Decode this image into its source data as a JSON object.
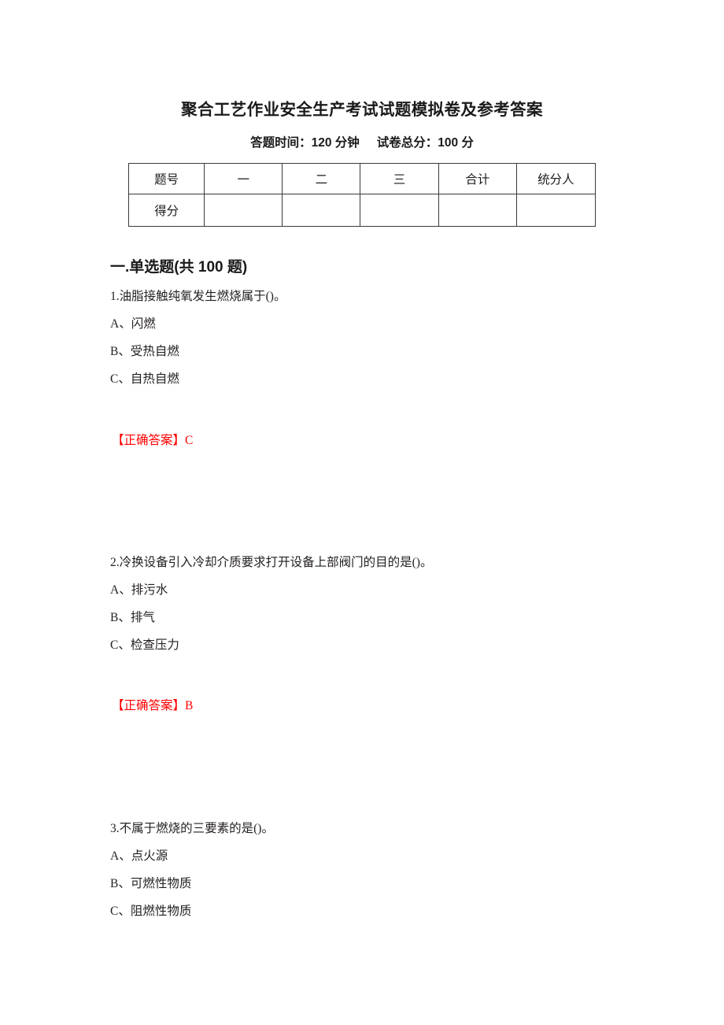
{
  "document": {
    "title": "聚合工艺作业安全生产考试试题模拟卷及参考答案",
    "subtitle_time": "答题时间：120 分钟",
    "subtitle_total": "试卷总分：100 分",
    "answer_color": "#ff0000",
    "text_color": "#231f20"
  },
  "score_table": {
    "header_row": [
      "题号",
      "一",
      "二",
      "三",
      "合计",
      "统分人"
    ],
    "score_row": [
      "得分",
      "",
      "",
      "",
      "",
      ""
    ]
  },
  "sections": [
    {
      "heading": "一.单选题(共 100 题)"
    }
  ],
  "questions": [
    {
      "stem": "1.油脂接触纯氧发生燃烧属于()。",
      "options": [
        {
          "key": "A、",
          "text": "闪燃"
        },
        {
          "key": "B、",
          "text": "受热自燃"
        },
        {
          "key": "C、",
          "text": "自热自燃"
        }
      ],
      "answer_label": "【正确答案】",
      "answer_value": "C"
    },
    {
      "stem": "2.冷换设备引入冷却介质要求打开设备上部阀门的目的是()。",
      "options": [
        {
          "key": "A、",
          "text": "排污水"
        },
        {
          "key": "B、",
          "text": "排气"
        },
        {
          "key": "C、",
          "text": "检查压力"
        }
      ],
      "answer_label": "【正确答案】",
      "answer_value": "B"
    },
    {
      "stem": "3.不属于燃烧的三要素的是()。",
      "options": [
        {
          "key": "A、",
          "text": "点火源"
        },
        {
          "key": "B、",
          "text": "可燃性物质"
        },
        {
          "key": "C、",
          "text": "阻燃性物质"
        }
      ],
      "answer_label": "",
      "answer_value": ""
    }
  ]
}
